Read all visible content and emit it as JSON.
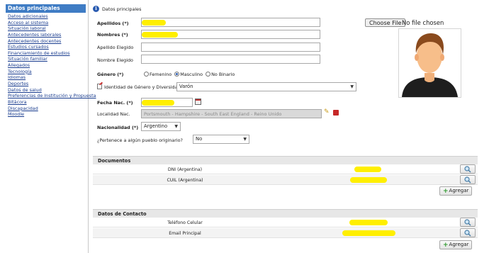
{
  "sidebar": {
    "active": "Datos principales",
    "items": [
      "Datos adicionales",
      "Acceso al sistema",
      "Situación laboral",
      "Antecedentes laborales",
      "Antecedentes docentes",
      "Estudios cursados",
      "Financiamiento de estudios",
      "Situación familiar",
      "Allegados",
      "Tecnología",
      "Idiomas",
      "Deportes",
      "Datos de salud",
      "Preferencias de Institución y Propuesta",
      "Bitácora",
      "Discapacidad",
      "Moodle"
    ]
  },
  "header": {
    "title": "Datos principales"
  },
  "photo": {
    "button": "Choose File",
    "status": "No file chosen"
  },
  "form": {
    "apellidos_label": "Apellidos (*)",
    "nombres_label": "Nombres (*)",
    "apellido_elegido_label": "Apellido Elegido",
    "nombre_elegido_label": "Nombre Elegido",
    "genero_label": "Género (*)",
    "genero_options": [
      "Femenino",
      "Masculino",
      "No Binario"
    ],
    "genero_selected": "Masculino",
    "identidad_label": "Identidad de Género y Diversidad",
    "identidad_value": "Varón",
    "fecha_label": "Fecha Nac. (*)",
    "localidad_label": "Localidad Nac.",
    "localidad_value": "Portsmouth - Hampshire - South East England - Reino Unido",
    "nacionalidad_label": "Nacionalidad (*)",
    "nacionalidad_value": "Argentino",
    "pueblo_label": "¿Pertenece a algún pueblo originario?",
    "pueblo_value": "No"
  },
  "documentos": {
    "title": "Documentos",
    "rows": [
      "DNI (Argentina)",
      "CUIL (Argentina)"
    ],
    "add_label": "Agregar"
  },
  "contacto": {
    "title": "Datos de Contacto",
    "rows": [
      "Teléfono Celular",
      "Email Principal"
    ],
    "add_label": "Agregar"
  },
  "colors": {
    "accent": "#3f7cc4",
    "redaction": "#ffef00",
    "link": "#1a3d8f"
  }
}
